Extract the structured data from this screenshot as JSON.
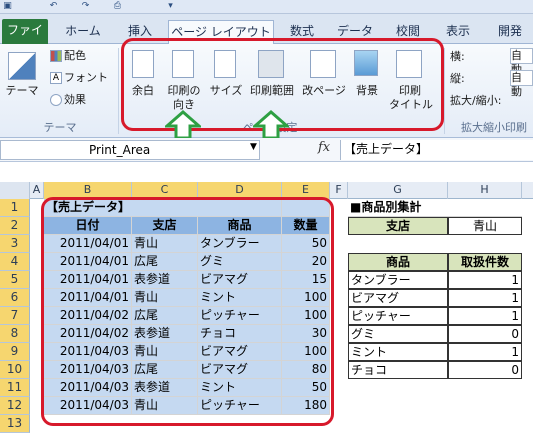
{
  "tabs": [
    {
      "label": "ファイル"
    },
    {
      "label": "ホーム"
    },
    {
      "label": "挿入"
    },
    {
      "label": "ページ レイアウト"
    },
    {
      "label": "数式"
    },
    {
      "label": "データ"
    },
    {
      "label": "校閲"
    },
    {
      "label": "表示"
    },
    {
      "label": "開発"
    }
  ],
  "ribbon": {
    "theme_label": "テーマ",
    "colors_label": "配色",
    "fonts_label": "フォント",
    "effects_label": "効果",
    "theme_group": "テーマ",
    "margins": "余白",
    "orientation_1": "印刷の",
    "orientation_2": "向き",
    "size": "サイズ",
    "print_area": "印刷範囲",
    "breaks": "改ページ",
    "background": "背景",
    "print_titles_1": "印刷",
    "print_titles_2": "タイトル",
    "page_setup_group": "ページ設定",
    "width_label": "横:",
    "height_label": "縦:",
    "width_value": "自動",
    "height_value": "自動",
    "scale_label": "拡大/縮小:",
    "scale_group": "拡大縮小印刷"
  },
  "formula_bar": {
    "name_box": "Print_Area",
    "fx": "fx",
    "content": "【売上データ】"
  },
  "columns": [
    "A",
    "B",
    "C",
    "D",
    "E",
    "F",
    "G",
    "H"
  ],
  "rows": [
    "1",
    "2",
    "3",
    "4",
    "5",
    "6",
    "7",
    "8",
    "9",
    "10",
    "11",
    "12",
    "13"
  ],
  "sheet": {
    "title": "【売上データ】",
    "headers": [
      "日付",
      "支店",
      "商品",
      "数量"
    ],
    "data": [
      [
        "2011/04/01",
        "青山",
        "タンブラー",
        "50"
      ],
      [
        "2011/04/01",
        "広尾",
        "グミ",
        "20"
      ],
      [
        "2011/04/01",
        "表参道",
        "ビアマグ",
        "15"
      ],
      [
        "2011/04/01",
        "青山",
        "ミント",
        "100"
      ],
      [
        "2011/04/02",
        "広尾",
        "ピッチャー",
        "100"
      ],
      [
        "2011/04/02",
        "表参道",
        "チョコ",
        "30"
      ],
      [
        "2011/04/03",
        "青山",
        "ビアマグ",
        "100"
      ],
      [
        "2011/04/03",
        "広尾",
        "ビアマグ",
        "80"
      ],
      [
        "2011/04/03",
        "表参道",
        "ミント",
        "50"
      ],
      [
        "2011/04/03",
        "青山",
        "ピッチャー",
        "180"
      ]
    ],
    "summary_title": "■商品別集計",
    "branch_label": "支店",
    "branch_value": "青山",
    "product_header": "商品",
    "count_header": "取扱件数",
    "summary": [
      [
        "タンブラー",
        "1"
      ],
      [
        "ビアマグ",
        "1"
      ],
      [
        "ピッチャー",
        "1"
      ],
      [
        "グミ",
        "0"
      ],
      [
        "ミント",
        "1"
      ],
      [
        "チョコ",
        "0"
      ]
    ]
  },
  "colors": {
    "highlight": "#d7192b",
    "arrow": "#2ea043",
    "file_tab": "#2a7a3d"
  }
}
